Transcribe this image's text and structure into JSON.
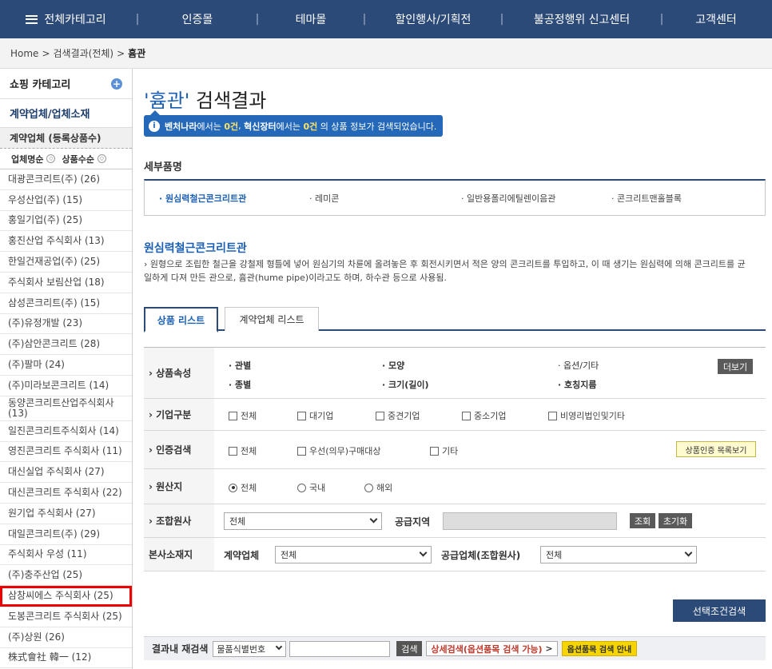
{
  "topnav": {
    "all_categories": "전체카테고리",
    "items": [
      "인증몰",
      "테마몰",
      "할인행사/기획전",
      "불공정행위 신고센터",
      "고객센터"
    ],
    "separator": "|"
  },
  "breadcrumb": {
    "home": "Home",
    "sep": ">",
    "search": "검색결과(전체)",
    "current": "흄관"
  },
  "sidebar": {
    "shopping_category": "쇼핑 카테고리",
    "plus": "+",
    "contract_vendors": "계약업체/업체소재",
    "list_title": "계약업체 (등록상품수)",
    "sort_name": "업체명순",
    "sort_count": "상품수순",
    "sort_glyph": "◇",
    "items": [
      "대광콘크리트(주) (26)",
      "우성산업(주) (15)",
      "홍일기업(주) (25)",
      "홍진산업 주식회사 (13)",
      "한일건재공업(주) (25)",
      "주식회사 보림산업 (18)",
      "삼성콘크리트(주) (15)",
      "(주)유정개발 (23)",
      "(주)삼안콘크리트 (28)",
      "(주)팔마 (24)",
      "(주)미라보콘크리트 (14)",
      "동양콘크리트산업주식회사 (13)",
      "일진콘크리트주식회사 (14)",
      "영진콘크리트 주식회사 (11)",
      "대신실업 주식회사 (27)",
      "대신콘크리트 주식회사 (22)",
      "원기업 주식회사 (27)",
      "대일콘크리트(주) (29)",
      "주식회사 우성 (11)",
      "(주)충주산업 (25)",
      "삼창씨에스 주식회사 (25)",
      "도봉콘크리트 주식회사 (25)",
      "(주)상원 (26)",
      "株式會社 韓一 (12)"
    ],
    "highlight_index": 20
  },
  "main": {
    "title_keyword": "'흄관'",
    "title_suffix": "검색결과",
    "notice": {
      "icon": "i",
      "venture": "벤처나라",
      "part1": "에서는",
      "count1": "0건",
      "sep": ",",
      "innov": "혁신장터",
      "part2": "에서는",
      "count2": "0건",
      "part3": "의 상품 정보가 검색되었습니다."
    },
    "detail_label": "세부품명",
    "detail_items": [
      "원심력철근콘크리트관",
      "레미콘",
      "일반용폴리에틸렌이음관",
      "콘크리트맨홀블록"
    ],
    "desc_title": "원심력철근콘크리트관",
    "desc_text": "원형으로 조립한 철근을 강철제 형틀에 넣어 원심기의 차륜에 올려놓은 후 회전시키면서 적은 양의 콘크리트를 투입하고, 이 때 생기는 원심력에 의해 콘크리트를 균일하게 다져 만든 관으로, 흄관(hume pipe)이라고도 하며, 하수관 등으로 사용됨.",
    "tabs": [
      "상품 리스트",
      "계약업체 리스트"
    ],
    "filters": {
      "attr_head": "상품속성",
      "attrs": [
        "관별",
        "모양",
        "옵션/기타",
        "종별",
        "크기(길이)",
        "호칭지름"
      ],
      "more": "더보기",
      "company_head": "기업구분",
      "company_opts": [
        "전체",
        "대기업",
        "중견기업",
        "중소기업",
        "비영리법인및기타"
      ],
      "cert_head": "인증검색",
      "cert_opts": [
        "전체",
        "우선(의무)구매대상",
        "기타"
      ],
      "cert_list_btn": "상품인증 목록보기",
      "origin_head": "원산지",
      "origin_opts": [
        "전체",
        "국내",
        "해외"
      ],
      "material_head": "조합원사",
      "material_select": "전체",
      "supply_region": "공급지역",
      "inquiry": "조회",
      "reset": "초기화",
      "hq_head": "본사소재지",
      "contract_vendor": "계약업체",
      "contract_select": "전체",
      "supplier": "공급업체(조합원사)",
      "supplier_select": "전체"
    },
    "search_button": "선택조건검색",
    "research": {
      "label": "결과내 재검색",
      "select": "물품식별번호",
      "input_value": "",
      "search": "검색",
      "advanced": "상세검색(옵션품목 검색 가능)",
      "advanced_arrow": ">",
      "option_guide": "옵션품목 검색 안내"
    }
  }
}
